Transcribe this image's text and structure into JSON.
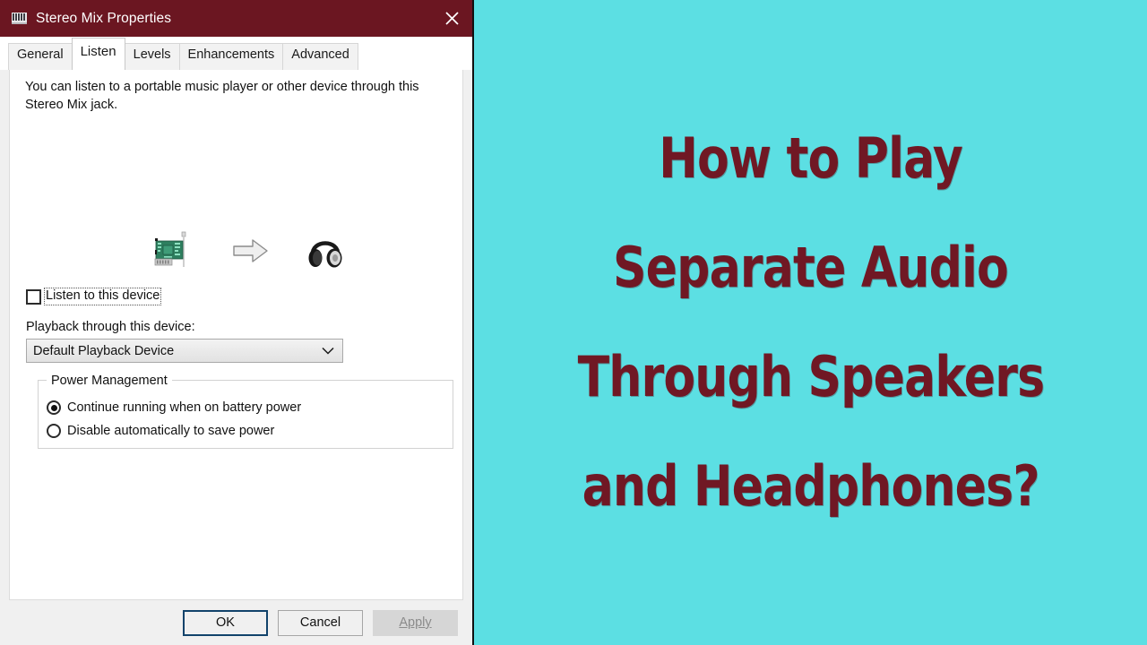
{
  "window": {
    "title": "Stereo Mix Properties",
    "icon": "sound-card-icon",
    "close_label": "✕"
  },
  "tabs": [
    {
      "label": "General",
      "active": false
    },
    {
      "label": "Listen",
      "active": true
    },
    {
      "label": "Levels",
      "active": false
    },
    {
      "label": "Enhancements",
      "active": false
    },
    {
      "label": "Advanced",
      "active": false
    }
  ],
  "panel": {
    "description": "You can listen to a portable music player or other device through this Stereo Mix jack.",
    "device_graphic": {
      "source_icon": "sound-card-icon",
      "arrow_icon": "right-arrow-icon",
      "target_icon": "headphones-icon"
    },
    "listen_checkbox": {
      "label": "Listen to this device",
      "checked": false,
      "focused": true
    },
    "playback": {
      "label": "Playback through this device:",
      "selected": "Default Playback Device",
      "options": [
        "Default Playback Device"
      ]
    },
    "power_management": {
      "legend": "Power Management",
      "options": [
        {
          "label": "Continue running when on battery power",
          "selected": true
        },
        {
          "label": "Disable automatically to save power",
          "selected": false
        }
      ]
    }
  },
  "footer": {
    "ok_label": "OK",
    "cancel_label": "Cancel",
    "apply_label": "Apply",
    "apply_disabled": true
  },
  "right_panel": {
    "background_color": "#5cdfe3",
    "text_color": "#701824",
    "headline_lines": [
      "How to Play",
      "Separate Audio",
      "Through Speakers",
      "and Headphones?"
    ]
  }
}
